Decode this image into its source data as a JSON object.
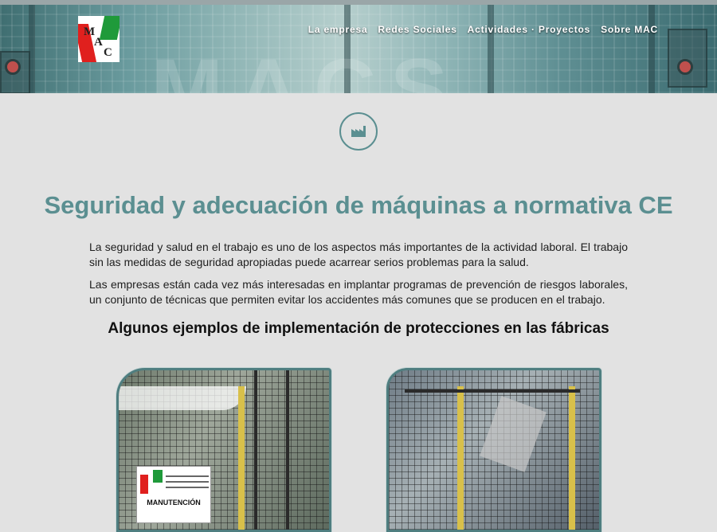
{
  "header": {
    "logo_letters": [
      "M",
      "A",
      "C"
    ],
    "watermark": "MACS",
    "nav": [
      {
        "label": "La empresa"
      },
      {
        "label": "Redes Sociales"
      },
      {
        "label": "Actividades · Proyectos"
      },
      {
        "label": "Sobre MAC"
      }
    ]
  },
  "main": {
    "icon": "factory-icon",
    "title": "Seguridad y adecuación de máquinas a normativa CE",
    "paragraphs": [
      "La seguridad y salud en el trabajo es uno de los aspectos más importantes de la actividad laboral. El trabajo sin las medidas de seguridad apropiadas puede acarrear serios problemas para la salud.",
      "Las empresas están cada vez más interesadas en implantar programas de prevención de riesgos laborales, un conjunto de técnicas que permiten evitar los accidentes más comunes que se producen en el trabajo."
    ],
    "subtitle": "Algunos ejemplos de implementación de protecciones en las fábricas",
    "badge_text": "MANUTENCIÓN"
  },
  "colors": {
    "accent": "#5b8f91",
    "background": "#e2e2e2",
    "text": "#1e1e1e"
  }
}
